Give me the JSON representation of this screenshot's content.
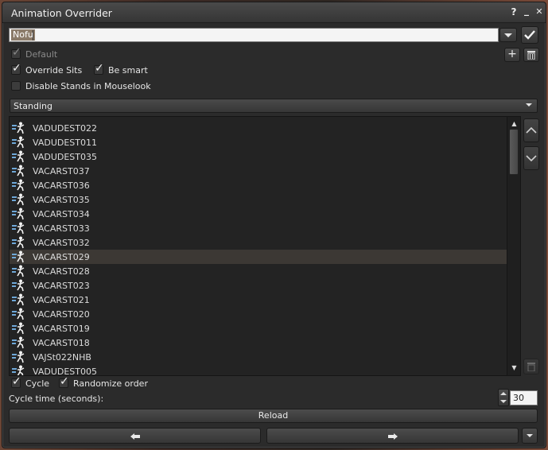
{
  "window": {
    "title": "Animation Overrider",
    "help_label": "?",
    "minimize_label": "_",
    "close_label": "✕"
  },
  "set_name": {
    "value": "Nofu"
  },
  "checkboxes": {
    "default_label": "Default",
    "override_sits_label": "Override Sits",
    "be_smart_label": "Be smart",
    "disable_stands_label": "Disable Stands in Mouselook",
    "cycle_label": "Cycle",
    "randomize_label": "Randomize order"
  },
  "state_dropdown": {
    "selected": "Standing"
  },
  "animations": [
    "VADUDEST022",
    "VADUDEST011",
    "VADUDEST035",
    "VACARST037",
    "VACARST036",
    "VACARST035",
    "VACARST034",
    "VACARST033",
    "VACARST032",
    "VACARST029",
    "VACARST028",
    "VACARST023",
    "VACARST021",
    "VACARST020",
    "VACARST019",
    "VACARST018",
    "VAJSt022NHB",
    "VADUDEST005"
  ],
  "selected_animation": "VACARST029",
  "cycle_time": {
    "label": "Cycle time (seconds):",
    "value": "30"
  },
  "buttons": {
    "reload_label": "Reload",
    "prev_label": "🡄",
    "next_label": "🡆"
  }
}
